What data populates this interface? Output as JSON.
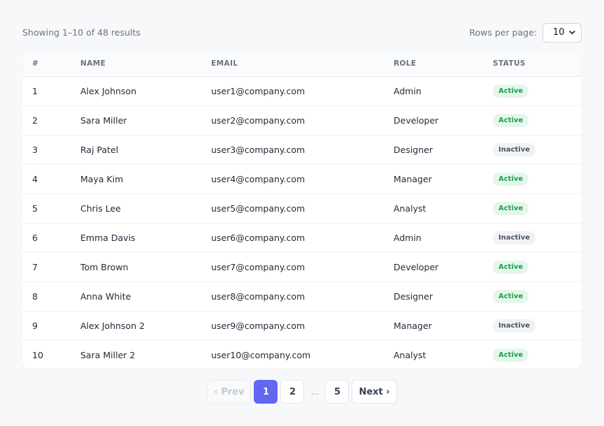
{
  "summary": "Showing 1–10 of 48 results",
  "rows_per_page": {
    "label": "Rows per page:",
    "selected": "10"
  },
  "table": {
    "headers": [
      "#",
      "NAME",
      "EMAIL",
      "ROLE",
      "STATUS"
    ],
    "rows": [
      {
        "num": "1",
        "name": "Alex Johnson",
        "email": "user1@company.com",
        "role": "Admin",
        "status": "Active"
      },
      {
        "num": "2",
        "name": "Sara Miller",
        "email": "user2@company.com",
        "role": "Developer",
        "status": "Active"
      },
      {
        "num": "3",
        "name": "Raj Patel",
        "email": "user3@company.com",
        "role": "Designer",
        "status": "Inactive"
      },
      {
        "num": "4",
        "name": "Maya Kim",
        "email": "user4@company.com",
        "role": "Manager",
        "status": "Active"
      },
      {
        "num": "5",
        "name": "Chris Lee",
        "email": "user5@company.com",
        "role": "Analyst",
        "status": "Active"
      },
      {
        "num": "6",
        "name": "Emma Davis",
        "email": "user6@company.com",
        "role": "Admin",
        "status": "Inactive"
      },
      {
        "num": "7",
        "name": "Tom Brown",
        "email": "user7@company.com",
        "role": "Developer",
        "status": "Active"
      },
      {
        "num": "8",
        "name": "Anna White",
        "email": "user8@company.com",
        "role": "Designer",
        "status": "Active"
      },
      {
        "num": "9",
        "name": "Alex Johnson 2",
        "email": "user9@company.com",
        "role": "Manager",
        "status": "Inactive"
      },
      {
        "num": "10",
        "name": "Sara Miller 2",
        "email": "user10@company.com",
        "role": "Analyst",
        "status": "Active"
      }
    ]
  },
  "pagination": {
    "prev": "‹ Prev",
    "pages": [
      "1",
      "2"
    ],
    "ellipsis": "...",
    "last": "5",
    "next": "Next ›",
    "current": "1"
  },
  "colors": {
    "accent": "#6366f1",
    "active_bg": "#e6f6ec",
    "active_text": "#16a34a",
    "inactive_bg": "#f1f2f5",
    "inactive_text": "#4b5563"
  },
  "icons": {
    "select_arrow": "chevron-down-icon"
  }
}
